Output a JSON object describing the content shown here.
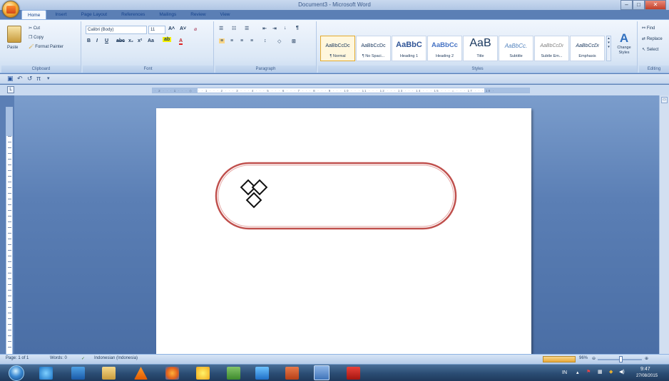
{
  "window": {
    "title": "Document3 - Microsoft Word"
  },
  "ribbon": {
    "tabs": [
      "Home",
      "Insert",
      "Page Layout",
      "References",
      "Mailings",
      "Review",
      "View"
    ],
    "active_tab": "Home",
    "clipboard": {
      "label": "Clipboard",
      "paste": "Paste",
      "cut": "Cut",
      "copy": "Copy",
      "format_painter": "Format Painter"
    },
    "font": {
      "label": "Font",
      "family": "Calibri (Body)",
      "size": "11"
    },
    "paragraph": {
      "label": "Paragraph"
    },
    "styles": {
      "label": "Styles",
      "items": [
        {
          "preview": "AaBbCcDc",
          "name": "¶ Normal",
          "selected": true
        },
        {
          "preview": "AaBbCcDc",
          "name": "¶ No Spaci..."
        },
        {
          "preview": "AaBbC",
          "name": "Heading 1"
        },
        {
          "preview": "AaBbCc",
          "name": "Heading 2"
        },
        {
          "preview": "AaB",
          "name": "Title"
        },
        {
          "preview": "AaBbCc.",
          "name": "Subtitle"
        },
        {
          "preview": "AaBbCcDi",
          "name": "Subtle Em..."
        },
        {
          "preview": "AaBbCcDi",
          "name": "Emphasis"
        }
      ],
      "change_styles": "Change Styles"
    },
    "editing": {
      "label": "Editing",
      "find": "Find",
      "replace": "Replace",
      "select": "Select"
    }
  },
  "status": {
    "page": "Page: 1 of 1",
    "words": "Words: 0",
    "language": "Indonesian (Indonesia)",
    "zoom": "96%"
  },
  "tray": {
    "lang": "IN",
    "time": "9:47",
    "date": "27/08/2015"
  },
  "document": {
    "shape": "rounded-rectangle",
    "shape_color": "#c0504d"
  }
}
